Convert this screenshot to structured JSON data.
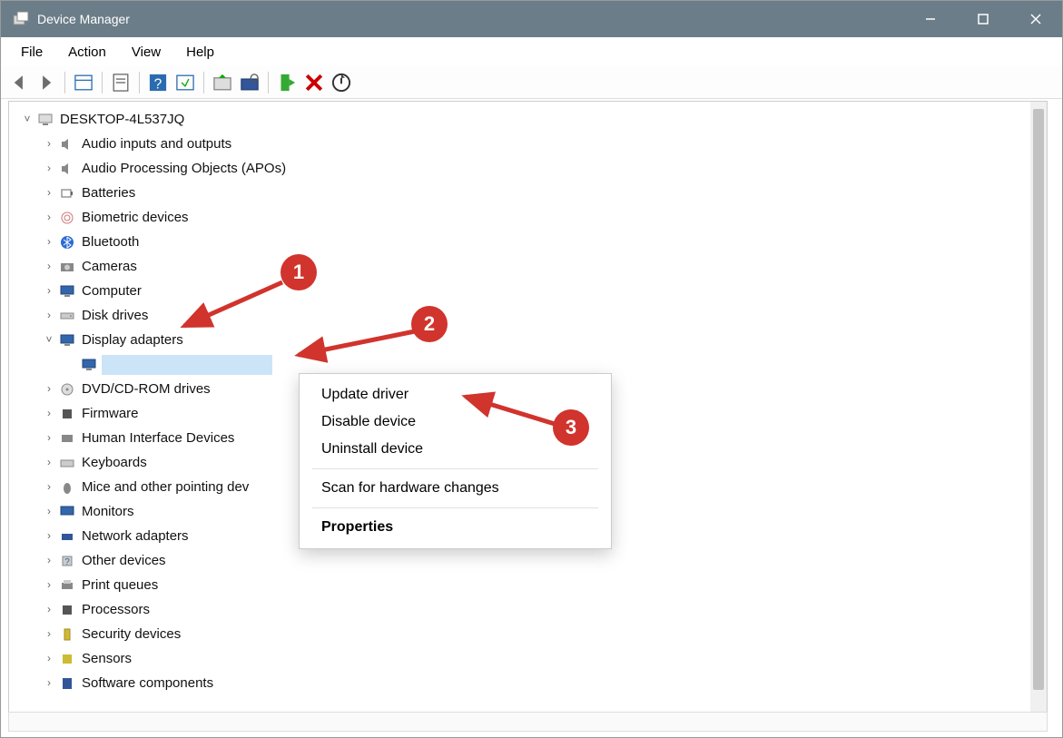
{
  "window": {
    "title": "Device Manager"
  },
  "menu": {
    "file": "File",
    "action": "Action",
    "view": "View",
    "help": "Help"
  },
  "toolbar_icons": {
    "back": "back",
    "forward": "forward",
    "showmenu": "showmenu",
    "properties": "properties",
    "help": "help",
    "updatek": "update",
    "scan": "scan",
    "uninstall": "uninstall",
    "enable": "enable",
    "disable": "disable",
    "moreactions": "moreactions"
  },
  "tree": {
    "root": "DESKTOP-4L537JQ",
    "items": [
      "Audio inputs and outputs",
      "Audio Processing Objects (APOs)",
      "Batteries",
      "Biometric devices",
      "Bluetooth",
      "Cameras",
      "Computer",
      "Disk drives",
      "Display adapters",
      "DVD/CD-ROM drives",
      "Firmware",
      "Human Interface Devices",
      "Keyboards",
      "Mice and other pointing dev",
      "Monitors",
      "Network adapters",
      "Other devices",
      "Print queues",
      "Processors",
      "Security devices",
      "Sensors",
      "Software components"
    ],
    "selected_child_label": ""
  },
  "context_menu": {
    "update": "Update driver",
    "disable": "Disable device",
    "uninstall": "Uninstall device",
    "scan": "Scan for hardware changes",
    "properties": "Properties"
  },
  "callouts": {
    "one": "1",
    "two": "2",
    "three": "3"
  }
}
